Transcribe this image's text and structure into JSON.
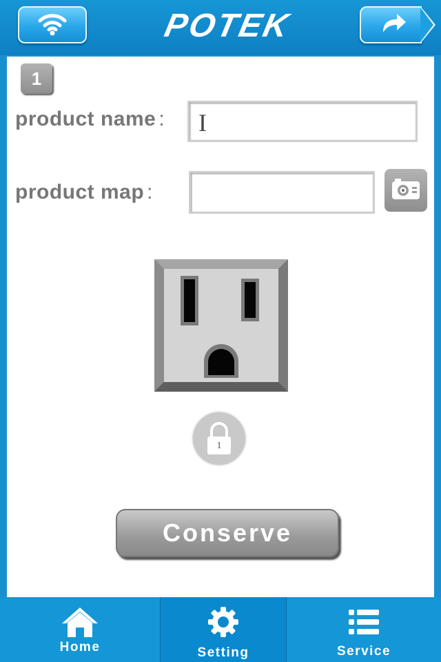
{
  "header": {
    "brand": "POTEK",
    "left_icon": "wifi-icon",
    "right_icon": "share-arrow-icon"
  },
  "form": {
    "slot_number": "1",
    "product_name_label": "product  name",
    "product_name_sep": ":",
    "product_name_value": "",
    "product_map_label": "product  map",
    "product_map_sep": ":",
    "product_map_value": "",
    "camera_icon": "camera-icon"
  },
  "device": {
    "image": "outlet-icon",
    "lock_number": "1"
  },
  "actions": {
    "conserve_label": "Conserve"
  },
  "tabbar": {
    "items": [
      {
        "label": "Home",
        "icon": "home-icon",
        "active": false
      },
      {
        "label": "Setting",
        "icon": "gear-icon",
        "active": true
      },
      {
        "label": "Service",
        "icon": "list-icon",
        "active": false
      }
    ]
  },
  "colors": {
    "frame_blue": "#1a8fcf",
    "button_gray": "#9a9a9a",
    "label_gray": "#777777"
  }
}
